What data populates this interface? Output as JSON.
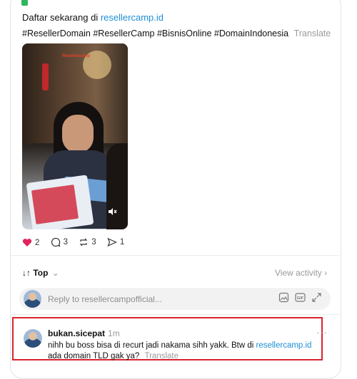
{
  "post": {
    "top_line": "Daftar sekarang di ",
    "top_link": "resellercamp.id",
    "hashtags": "#ResellerDomain #ResellerCamp #BisnisOnline #DomainIndonesia",
    "translate_label": "Translate",
    "media": {
      "logo_text": "Resellercamp"
    },
    "actions": {
      "likes": "2",
      "comments": "3",
      "reposts": "3",
      "shares": "1"
    }
  },
  "replies_header": {
    "sort_label": "Top",
    "view_activity": "View activity"
  },
  "reply_box": {
    "placeholder": "Reply to resellercampofficial..."
  },
  "comment": {
    "username": "bukan.sicepat",
    "time": "1m",
    "text_before": "nihh bu boss bisa di recurt jadi nakama sihh yakk. Btw di ",
    "text_link": "resellercamp.id",
    "text_after": " ada domain TLD gak ya?",
    "translate_label": "Translate"
  },
  "colors": {
    "link": "#1e8fd6",
    "like": "#e0245e",
    "highlight_border": "#d9242f"
  }
}
